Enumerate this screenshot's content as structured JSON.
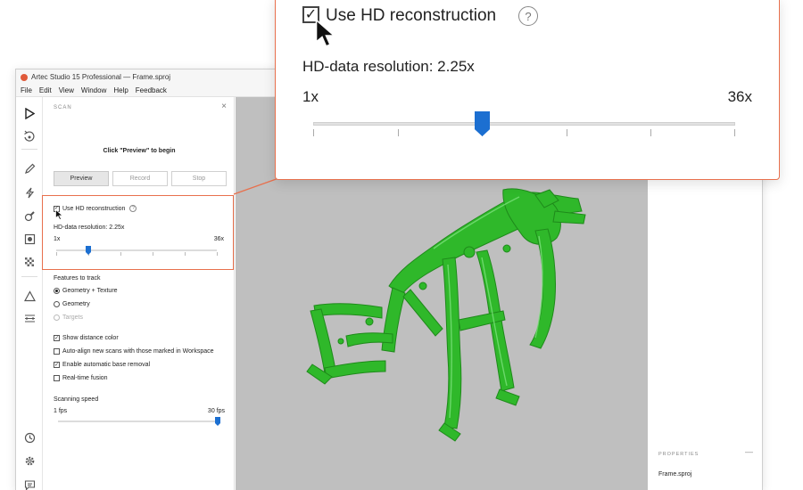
{
  "window": {
    "title": "Artec Studio 15 Professional — Frame.sproj",
    "menu": [
      "File",
      "Edit",
      "View",
      "Window",
      "Help",
      "Feedback"
    ]
  },
  "scan_panel": {
    "title": "SCAN",
    "close_glyph": "×",
    "hint": "Click \"Preview\" to begin",
    "buttons": {
      "preview": "Preview",
      "record": "Record",
      "stop": "Stop"
    },
    "hd": {
      "label": "Use HD reconstruction",
      "checked": true,
      "help_glyph": "?",
      "resolution_label": "HD-data resolution: 2.25x",
      "min_label": "1x",
      "max_label": "36x",
      "value_fraction": 0.4
    },
    "features": {
      "heading": "Features to track",
      "options": [
        {
          "label": "Geometry + Texture",
          "selected": true,
          "enabled": true
        },
        {
          "label": "Geometry",
          "selected": false,
          "enabled": true
        },
        {
          "label": "Targets",
          "selected": false,
          "enabled": false
        }
      ]
    },
    "checkboxes": [
      {
        "label": "Show distance color",
        "checked": true
      },
      {
        "label": "Auto-align new scans with those marked in Workspace",
        "checked": false
      },
      {
        "label": "Enable automatic base removal",
        "checked": true
      },
      {
        "label": "Real-time fusion",
        "checked": false
      }
    ],
    "speed": {
      "heading": "Scanning speed",
      "min_label": "1 fps",
      "max_label": "30 fps",
      "value_fraction": 1.0
    }
  },
  "properties": {
    "title": "PROPERTIES",
    "collapse_glyph": "—",
    "file": "Frame.sproj"
  },
  "zoom_callout": {
    "label": "Use HD reconstruction",
    "help_glyph": "?",
    "resolution_label": "HD-data resolution: 2.25x",
    "min_label": "1x",
    "max_label": "36x",
    "check_glyph": "✓"
  },
  "colors": {
    "accent": "#1c6fd1",
    "highlight": "#e8704d",
    "model": "#2fb82a",
    "viewport": "#bfbfbf"
  },
  "icons": {
    "rail": [
      "play-icon",
      "rotate-scan-icon",
      "pencil-icon",
      "lightning-icon",
      "brush-icon",
      "target-icon",
      "texture-icon",
      "measure-icon",
      "ruler-icon",
      "history-icon",
      "settings-icon",
      "chat-icon"
    ]
  }
}
